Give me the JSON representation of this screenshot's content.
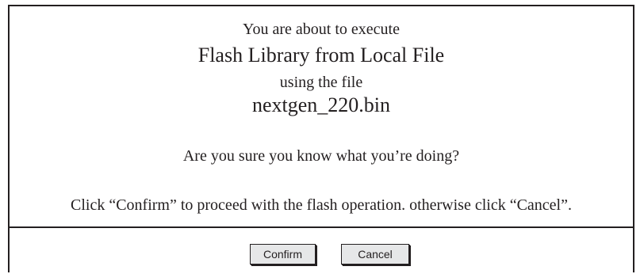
{
  "dialog": {
    "intro": "You are about to execute",
    "operation": "Flash Library from Local File",
    "using_text": "using the file",
    "filename": "nextgen_220.bin",
    "question": "Are you sure you know what you’re doing?",
    "instruction": "Click “Confirm” to proceed with the flash operation. otherwise click “Cancel”."
  },
  "buttons": {
    "confirm_label": "Confirm",
    "cancel_label": "Cancel"
  },
  "colors": {
    "border": "#231f20",
    "button_face": "#e6e7e8",
    "background": "#ffffff"
  }
}
